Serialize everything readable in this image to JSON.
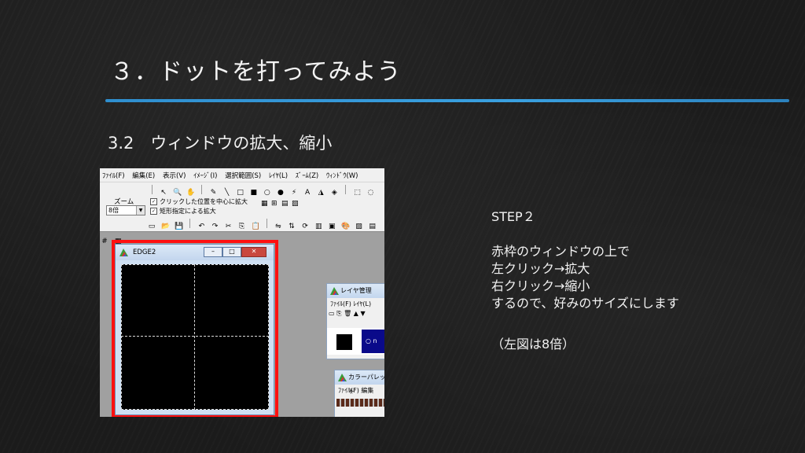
{
  "slide": {
    "title": "３．ドットを打ってみよう",
    "subtitle": "3.2　ウィンドウの拡大、縮小",
    "step_label": "STEP２",
    "description_lines": [
      "赤枠のウィンドウの上で",
      "左クリック→拡大",
      "右クリック→縮小",
      "するので、好みのサイズにします"
    ],
    "note": "（左図は8倍）",
    "accent_color": "#2f8fcf",
    "highlight_color": "#ff1010"
  },
  "app": {
    "menu": [
      "ﾌｧｲﾙ(F)",
      "編集(E)",
      "表示(V)",
      "ｲﾒｰｼﾞ(I)",
      "選択範囲(S)",
      "ﾚｲﾔ(L)",
      "ｽﾞｰﾑ(Z)",
      "ｳｨﾝﾄﾞｳ(W)"
    ],
    "zoom_label": "ズーム",
    "zoom_value": "8倍",
    "check_center": "クリックした位置を中心に拡大",
    "check_rect": "矩形指定による拡大",
    "edge_window_title": "EDGE2",
    "layer_window_title": "レイヤ管理",
    "layer_menu": [
      "ﾌｧｲﾙ(F)",
      "ﾚｲﾔ(L)"
    ],
    "layer_item_text": "○ n",
    "palette_window_title": "カラーパレット",
    "palette_menu": [
      "ﾌｧｲﾙ(F)",
      "編集"
    ],
    "window_buttons": [
      "–",
      "□",
      "✕"
    ]
  }
}
